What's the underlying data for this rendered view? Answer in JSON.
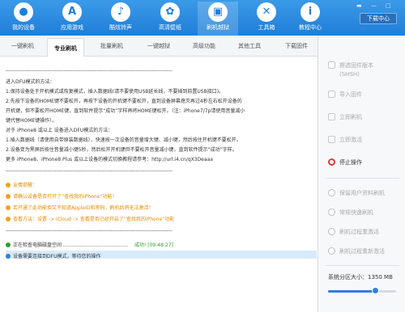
{
  "toolbar": {
    "items": [
      {
        "label": "我的设备",
        "icon": "apple-icon"
      },
      {
        "label": "应用游戏",
        "icon": "app-store-icon"
      },
      {
        "label": "酷炫铃声",
        "icon": "bell-icon"
      },
      {
        "label": "高清壁纸",
        "icon": "wallpaper-icon"
      },
      {
        "label": "刷机越狱",
        "icon": "box-icon"
      },
      {
        "label": "工具箱",
        "icon": "tools-icon"
      },
      {
        "label": "教程中心",
        "icon": "info-icon"
      }
    ],
    "active_index": 4,
    "download_center": "下载中心",
    "accent": "#1f7ed8"
  },
  "tabs": [
    "一键刷机",
    "专业刷机",
    "批量刷机",
    "一键越狱",
    "高级功能",
    "其他工具",
    "下载固件"
  ],
  "active_tab": 1,
  "log": {
    "lines": [
      "-----------------------------------------------------------------------------------------------",
      "进入DFU模式的方法：",
      "1.保持设备处于开机模式或恢复模式，插入数据线(请不要使用USB延长线，不要插到前置USB接口)。",
      "2.先按下设备的HOME键不要松开，再按下设备的开机键不要松开，直到设备屏幕熄灭再过4秒左右松开设备的",
      "开机键，但不要松开HOME键，直到软件提示“成功”字样再将HOME键松开。（注：iPhone7/7p请使用音量减小",
      "键代替HOME键操作）。",
      "对于 iPhone8 或以上 设备进入DFU模式的方法：",
      "1.插入数据线（请使用自带原装数据线），快速按一次设备的音量增大键、减小键，然后按住开机键不要松开。",
      "2.设备变为黑屏后按住音量减小键5秒，然后松开开机键但不要松开音量减小键，直到软件提示“成功”字样。",
      "更多 iPhone8、iPhone8 Plus 或以上设备的模式切换教程请参考：http://url.i4.cn/qX3Deaaa",
      "-----------------------------------------------------------------------------------------------"
    ],
    "tips": [
      "友情提醒：",
      "请确认设备是否打开了“查找我的iPhone”功能！",
      "若开通了此功能但又不知道AppleID和密码，刷机后将无法激活！",
      "查看方法：设置 -> iCloud -> 查看是否已经开启了“查找我的iPhone”功能"
    ],
    "sep2": "-----------------------------------------------------------------------------------------------",
    "status": [
      {
        "text": "正在检查电脑磁盘空间 ..........................................",
        "result": "成功! [09:48:27]"
      },
      {
        "text": "设备需要连接到DFU模式，等待您的操作",
        "result": ""
      }
    ]
  },
  "right_panel": {
    "options": [
      {
        "label": "擦选固件版本",
        "sub": "(SHSH)",
        "enabled": false,
        "kind": "icon"
      },
      {
        "label": "导入固件",
        "enabled": false,
        "kind": "icon"
      },
      {
        "label": "立即刷机",
        "enabled": false,
        "kind": "icon"
      },
      {
        "label": "立即激活",
        "enabled": false,
        "kind": "icon"
      },
      {
        "label": "停止操作",
        "enabled": true,
        "kind": "stop"
      },
      {
        "label": "保留用户资料刷机",
        "enabled": false,
        "kind": "radio"
      },
      {
        "label": "常规快速刷机",
        "enabled": false,
        "kind": "radio"
      },
      {
        "label": "刷机过程重激活",
        "enabled": false,
        "kind": "radio"
      },
      {
        "label": "刷机过程重新激活",
        "enabled": false,
        "kind": "radio"
      }
    ],
    "partition_label": "系统分区大小：1350 MB",
    "partition_fraction": 0.7
  }
}
